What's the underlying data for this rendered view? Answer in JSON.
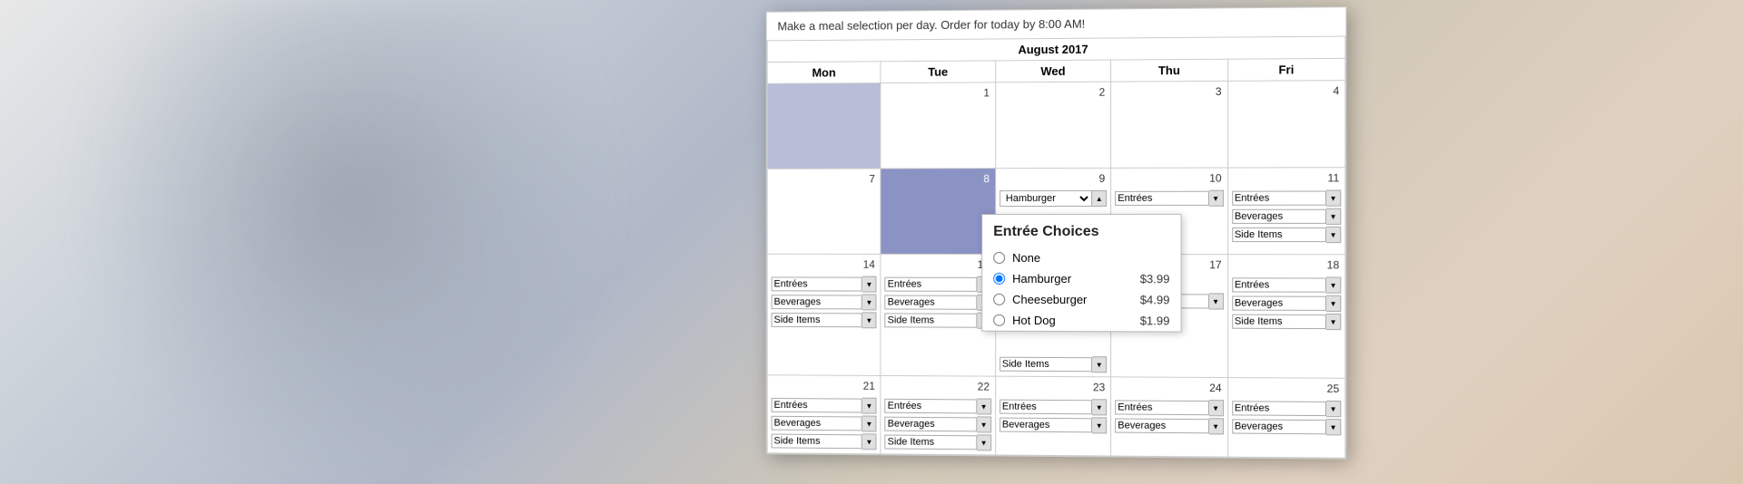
{
  "header": {
    "instruction": "Make a meal selection per day. Order for today by 8:00 AM!"
  },
  "calendar": {
    "month_year": "August 2017",
    "days": [
      "Mon",
      "Tue",
      "Wed",
      "Thu",
      "Fri"
    ],
    "weeks": [
      {
        "cells": [
          {
            "day": "",
            "date": "",
            "style": "blue",
            "dropdowns": []
          },
          {
            "day": "Tue",
            "date": "1",
            "style": "white",
            "dropdowns": []
          },
          {
            "day": "Wed",
            "date": "2",
            "style": "white",
            "dropdowns": []
          },
          {
            "day": "Thu",
            "date": "3",
            "style": "white",
            "dropdowns": []
          },
          {
            "day": "Fri",
            "date": "4",
            "style": "white",
            "dropdowns": []
          }
        ]
      },
      {
        "cells": [
          {
            "day": "Mon",
            "date": "7",
            "style": "white",
            "dropdowns": []
          },
          {
            "day": "Tue",
            "date": "8",
            "style": "blue-dark",
            "dropdowns": []
          },
          {
            "day": "Wed",
            "date": "9",
            "style": "white",
            "dropdowns": [
              "Hamburger"
            ],
            "has_popup": true
          },
          {
            "day": "Thu",
            "date": "10",
            "style": "white",
            "dropdowns": [
              "Entrées"
            ]
          },
          {
            "day": "Fri",
            "date": "11",
            "style": "white",
            "dropdowns": [
              "Entrées",
              "Beverages",
              "Side Items"
            ]
          }
        ]
      },
      {
        "cells": [
          {
            "day": "Mon",
            "date": "14",
            "style": "white",
            "dropdowns": [
              "Entrées",
              "Beverages",
              "Side Items"
            ]
          },
          {
            "day": "Tue",
            "date": "15",
            "style": "white",
            "dropdowns": [
              "Entrées",
              "Beverages",
              "Side Items"
            ]
          },
          {
            "day": "Wed",
            "date": "",
            "style": "white",
            "dropdowns": []
          },
          {
            "day": "Thu",
            "date": "17",
            "style": "white",
            "dropdowns": []
          },
          {
            "day": "Fri",
            "date": "18",
            "style": "white",
            "dropdowns": [
              "Entrées",
              "Beverages",
              "Side Items"
            ]
          }
        ]
      },
      {
        "cells": [
          {
            "day": "Mon",
            "date": "21",
            "style": "white",
            "dropdowns": [
              "Entrées",
              "Beverages",
              "Side Items"
            ]
          },
          {
            "day": "Tue",
            "date": "22",
            "style": "white",
            "dropdowns": [
              "Entrées",
              "Beverages",
              "Side Items"
            ]
          },
          {
            "day": "Wed",
            "date": "23",
            "style": "white",
            "dropdowns": [
              "Entrées",
              "Beverages"
            ]
          },
          {
            "day": "Thu",
            "date": "24",
            "style": "white",
            "dropdowns": [
              "Entrées",
              "Beverages"
            ]
          },
          {
            "day": "Fri",
            "date": "25",
            "style": "white",
            "dropdowns": [
              "Entrées",
              "Beverages"
            ]
          }
        ]
      }
    ]
  },
  "popup": {
    "title": "Entrée Choices",
    "items": [
      {
        "label": "None",
        "price": "",
        "selected": false
      },
      {
        "label": "Hamburger",
        "price": "$3.99",
        "selected": true
      },
      {
        "label": "Cheeseburger",
        "price": "$4.99",
        "selected": false
      },
      {
        "label": "Hot Dog",
        "price": "$1.99",
        "selected": false
      }
    ]
  },
  "dropdowns": {
    "entrees_label": "Entrées",
    "beverages_label": "Beverages",
    "side_items_label": "Side Items",
    "hamburger_label": "Hamburger"
  }
}
